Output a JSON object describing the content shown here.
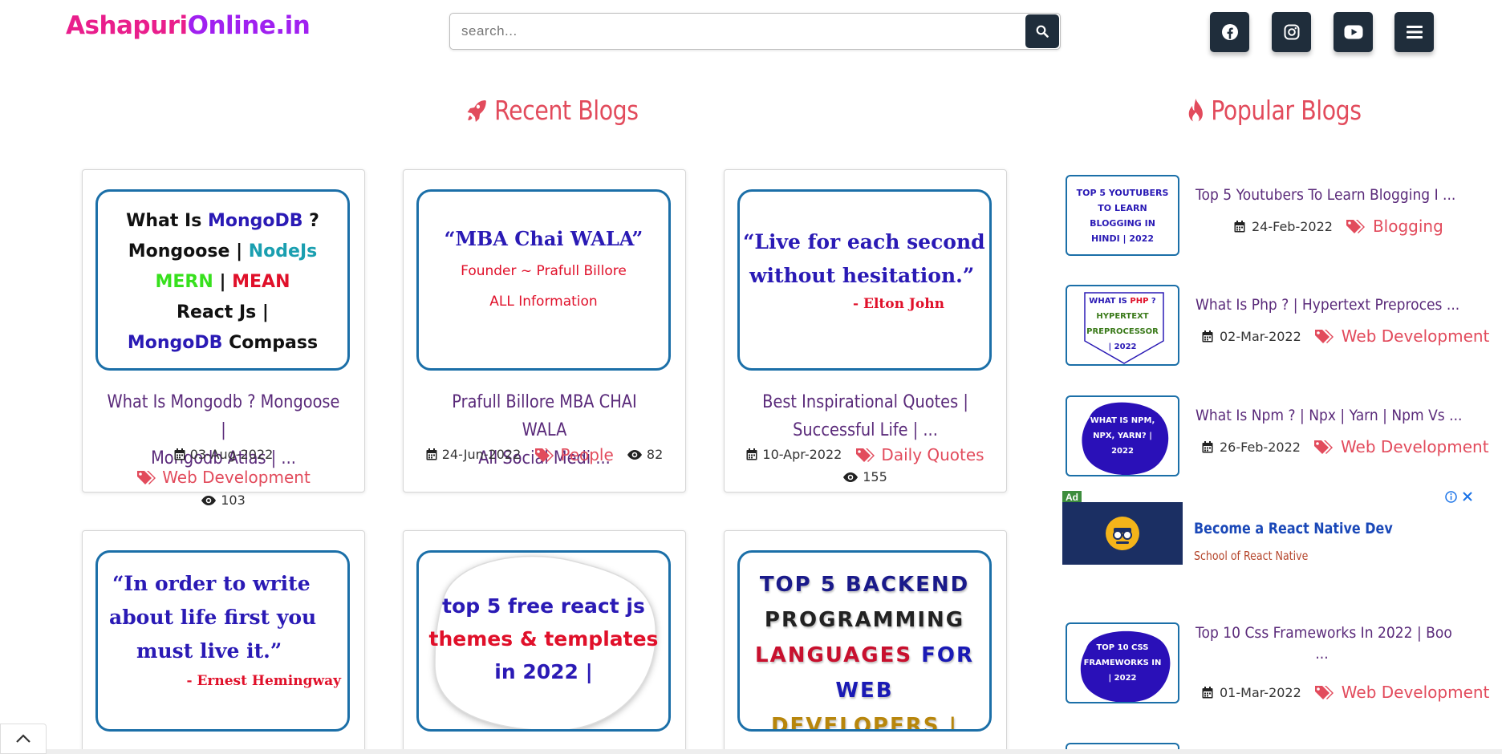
{
  "header": {
    "logo_part1": "Ashapuri",
    "logo_part2": "Online.in",
    "search_placeholder": "search...",
    "social": [
      "facebook-icon",
      "instagram-icon",
      "youtube-icon",
      "menu-icon"
    ]
  },
  "recent": {
    "heading": "Recent Blogs",
    "cards": [
      {
        "thumb_lines": [
          [
            "What Is ",
            "MongoDB",
            " ?"
          ],
          [
            "Mongoose | ",
            "NodeJs"
          ],
          [
            "MERN",
            " | ",
            "MEAN"
          ],
          [
            "React Js |"
          ],
          [
            "MongoDB",
            " Compass"
          ]
        ],
        "title_line1": "What Is Mongodb ? Mongoose |",
        "title_line2": "Mongodb Atlas | ...",
        "date": "03-Aug-2022",
        "category": "Web Development",
        "views": "103"
      },
      {
        "thumb_quote": "“MBA Chai WALA”",
        "thumb_sub1": "Founder ~ Prafull Billore",
        "thumb_sub2": "ALL Information",
        "title_line1": "Prafull Billore MBA CHAI WALA",
        "title_line2": "All Social Medi ...",
        "date": "24-Jun-2022",
        "category": "People",
        "views": "82"
      },
      {
        "thumb_quote1": "“Live for each second",
        "thumb_quote2": "without hesitation.”",
        "thumb_author": "- Elton John",
        "title_line1": "Best Inspirational Quotes |",
        "title_line2": "Successful Life | ...",
        "date": "10-Apr-2022",
        "category": "Daily Quotes",
        "views": "155"
      },
      {
        "thumb_quote1": "“In order to write",
        "thumb_quote2": "about life first you",
        "thumb_quote3": "must live it.”",
        "thumb_author": "- Ernest Hemingway"
      },
      {
        "thumb_line1": "top 5 free react js",
        "thumb_line2": "themes & templates",
        "thumb_line3": "in 2022 |"
      },
      {
        "thumb_line1": "TOP 5 BACKEND",
        "thumb_line2": "PROGRAMMING",
        "thumb_line3a": "LANGUAGES",
        "thumb_line3b": " FOR WEB",
        "thumb_line4": "DEVELOPERS |"
      }
    ]
  },
  "popular": {
    "heading": "Popular Blogs",
    "items": [
      {
        "thumb_text": "TOP 5 YOUTUBERS TO LEARN BLOGGING IN HINDI | 2022",
        "title": "Top 5 Youtubers To Learn Blogging I ...",
        "date": "24-Feb-2022",
        "category": "Blogging"
      },
      {
        "thumb_text1": "WHAT IS ",
        "thumb_text2": "PHP",
        "thumb_text3": " ?",
        "thumb_text4": "HYPERTEXT PREPROCESSOR",
        "thumb_text5": "| 2022",
        "title": "What Is Php ? | Hypertext Preproces ...",
        "date": "02-Mar-2022",
        "category": "Web Development"
      },
      {
        "thumb_text": "WHAT IS NPM, NPX, YARN? | 2022",
        "title": "What Is Npm ? | Npx | Yarn | Npm Vs ...",
        "date": "26-Feb-2022",
        "category": "Web Development"
      },
      {
        "thumb_text": "TOP 10 CSS FRAMEWORKS IN | 2022",
        "title_line1": "Top 10 Css Frameworks In 2022 | Boo",
        "title_line2": "...",
        "date": "01-Mar-2022",
        "category": "Web Development"
      }
    ]
  },
  "ad": {
    "badge": "Ad",
    "title": "Become a React Native Dev",
    "subtitle": "School of React Native"
  },
  "colors": {
    "accent": "#e24b5c",
    "title": "#5a2a7a",
    "dark_button": "#1f2d3b",
    "thumb_border": "#1b6fa8"
  }
}
